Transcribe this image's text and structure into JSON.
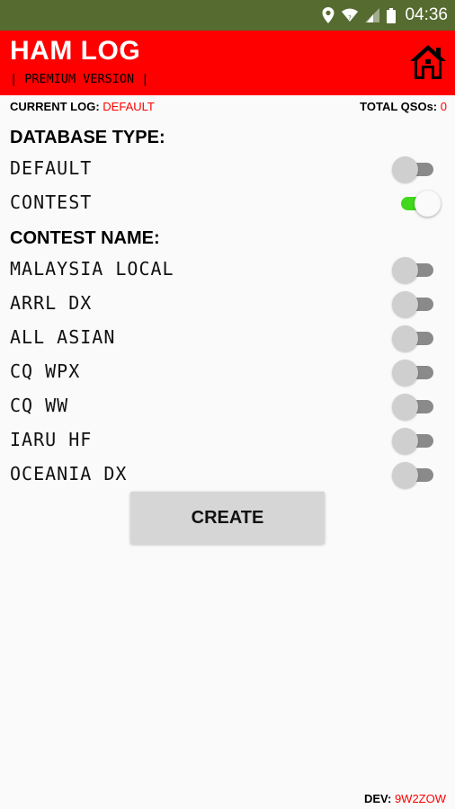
{
  "status_bar": {
    "time": "04:36",
    "icons": [
      "location-icon",
      "wifi-icon",
      "signal-icon",
      "battery-icon"
    ]
  },
  "app": {
    "title": "HAM LOG",
    "subtitle": "| PREMIUM VERSION |",
    "home_icon": "home-icon"
  },
  "info": {
    "current_log_label": "CURRENT LOG:",
    "current_log_value": "DEFAULT",
    "total_qsos_label": "TOTAL QSOs:",
    "total_qsos_value": "0"
  },
  "database": {
    "title": "DATABASE TYPE:",
    "options": [
      {
        "label": "DEFAULT",
        "on": false
      },
      {
        "label": "CONTEST",
        "on": true
      }
    ]
  },
  "contest": {
    "title": "CONTEST NAME:",
    "options": [
      {
        "label": "MALAYSIA LOCAL",
        "on": false
      },
      {
        "label": "ARRL DX",
        "on": false
      },
      {
        "label": "ALL ASIAN",
        "on": false
      },
      {
        "label": "CQ WPX",
        "on": false
      },
      {
        "label": "CQ WW",
        "on": false
      },
      {
        "label": "IARU HF",
        "on": false
      },
      {
        "label": "OCEANIA DX",
        "on": false
      }
    ]
  },
  "create_label": "CREATE",
  "footer": {
    "dev_label": "DEV:",
    "dev_value": "9W2ZOW"
  },
  "colors": {
    "status_bar": "#556b2f",
    "app_bar": "#ff0000",
    "switch_on": "#41d81d",
    "switch_off": "#8a8a8a",
    "accent_text": "#ff0000"
  }
}
